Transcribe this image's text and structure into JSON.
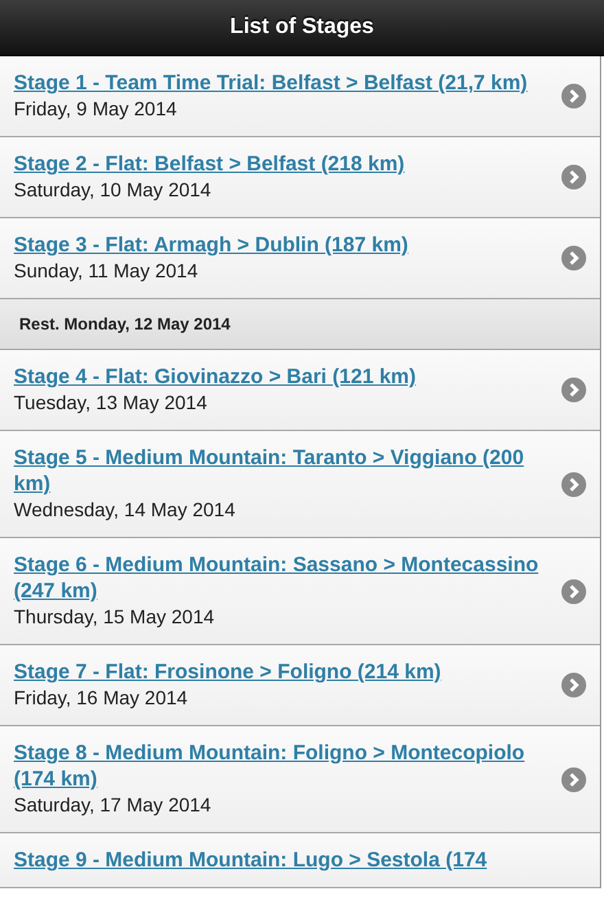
{
  "header": {
    "title": "List of Stages"
  },
  "items": [
    {
      "kind": "stage",
      "title": "Stage 1 - Team Time Trial: Belfast > Belfast (21,7 km)",
      "date": "Friday, 9 May 2014"
    },
    {
      "kind": "stage",
      "title": "Stage 2 - Flat: Belfast > Belfast (218 km)",
      "date": "Saturday, 10 May 2014"
    },
    {
      "kind": "stage",
      "title": "Stage 3 - Flat: Armagh > Dublin (187 km)",
      "date": "Sunday, 11 May 2014"
    },
    {
      "kind": "divider",
      "title": "Rest. Monday, 12 May 2014"
    },
    {
      "kind": "stage",
      "title": "Stage 4 - Flat: Giovinazzo > Bari (121 km)",
      "date": "Tuesday, 13 May 2014"
    },
    {
      "kind": "stage",
      "title": "Stage 5 - Medium Mountain: Taranto > Viggiano (200 km)",
      "date": "Wednesday, 14 May 2014"
    },
    {
      "kind": "stage",
      "title": "Stage 6 - Medium Mountain: Sassano > Montecassino (247 km)",
      "date": "Thursday, 15 May 2014"
    },
    {
      "kind": "stage",
      "title": "Stage 7 - Flat: Frosinone > Foligno (214 km)",
      "date": "Friday, 16 May 2014"
    },
    {
      "kind": "stage",
      "title": "Stage 8 - Medium Mountain: Foligno > Montecopiolo (174 km)",
      "date": "Saturday, 17 May 2014"
    },
    {
      "kind": "stage",
      "title": "Stage 9 - Medium Mountain: Lugo > Sestola (174"
    }
  ]
}
